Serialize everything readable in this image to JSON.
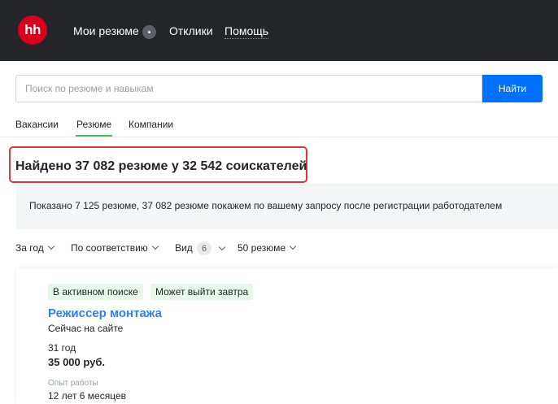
{
  "header": {
    "logo_text": "hh",
    "nav": {
      "my_resumes": "Мои резюме",
      "responses": "Отклики",
      "help": "Помощь"
    },
    "colors": {
      "background": "#232529",
      "logo": "#d6001c"
    }
  },
  "search": {
    "placeholder": "Поиск по резюме и навыкам",
    "value": "",
    "button_label": "Найти",
    "button_color": "#0070ff"
  },
  "tabs": [
    {
      "label": "Вакансии",
      "active": false
    },
    {
      "label": "Резюме",
      "active": true
    },
    {
      "label": "Компании",
      "active": false
    }
  ],
  "results": {
    "title": "Найдено 37 082 резюме у 32 542 соискателей",
    "highlight_color": "#e0353b",
    "notice": "Показано 7 125 резюме, 37 082 резюме покажем по вашему запросу после регистрации работодателем"
  },
  "filters": {
    "period": "За год",
    "sort": "По соответствию",
    "view": "Вид",
    "view_count": "6",
    "per_page": "50 резюме"
  },
  "resume_card": {
    "badges": [
      "В активном поиске",
      "Может выйти завтра"
    ],
    "title": "Режиссер монтажа",
    "online_status": "Сейчас на сайте",
    "age": "31 год",
    "salary": "35 000 руб.",
    "experience_label": "Опыт работы",
    "experience_value": "12 лет 6 месяцев",
    "title_color": "#2b7fff"
  }
}
